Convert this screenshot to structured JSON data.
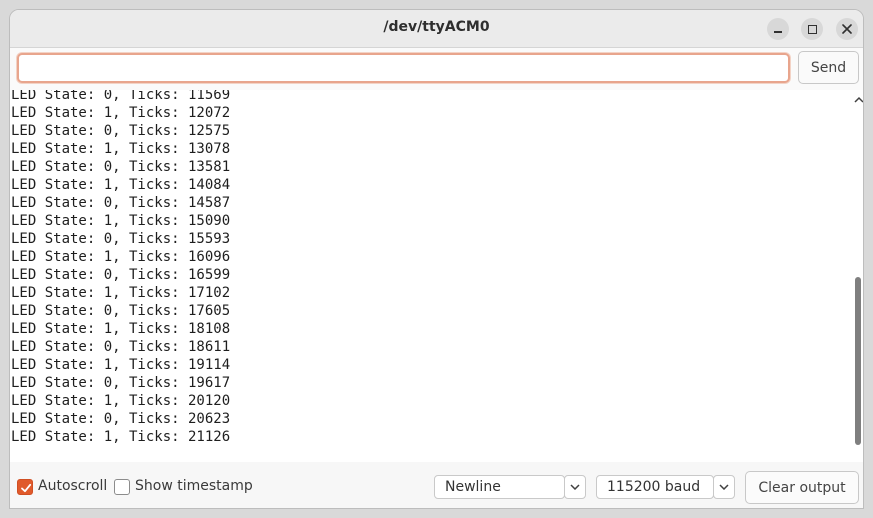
{
  "window": {
    "title": "/dev/ttyACM0"
  },
  "send": {
    "input_value": "",
    "input_placeholder": "",
    "button_label": "Send"
  },
  "output": {
    "lines": [
      "LED State: 0, Ticks: 11569",
      "LED State: 1, Ticks: 12072",
      "LED State: 0, Ticks: 12575",
      "LED State: 1, Ticks: 13078",
      "LED State: 0, Ticks: 13581",
      "LED State: 1, Ticks: 14084",
      "LED State: 0, Ticks: 14587",
      "LED State: 1, Ticks: 15090",
      "LED State: 0, Ticks: 15593",
      "LED State: 1, Ticks: 16096",
      "LED State: 0, Ticks: 16599",
      "LED State: 1, Ticks: 17102",
      "LED State: 0, Ticks: 17605",
      "LED State: 1, Ticks: 18108",
      "LED State: 0, Ticks: 18611",
      "LED State: 1, Ticks: 19114",
      "LED State: 0, Ticks: 19617",
      "LED State: 1, Ticks: 20120",
      "LED State: 0, Ticks: 20623",
      "LED State: 1, Ticks: 21126"
    ]
  },
  "footer": {
    "autoscroll_label": "Autoscroll",
    "autoscroll_checked": true,
    "timestamp_label": "Show timestamp",
    "timestamp_checked": false,
    "line_ending_selected": "Newline",
    "baud_selected": "115200 baud",
    "clear_label": "Clear output"
  },
  "colors": {
    "accent": "#e05a2b",
    "input_border": "#e8a58d"
  }
}
